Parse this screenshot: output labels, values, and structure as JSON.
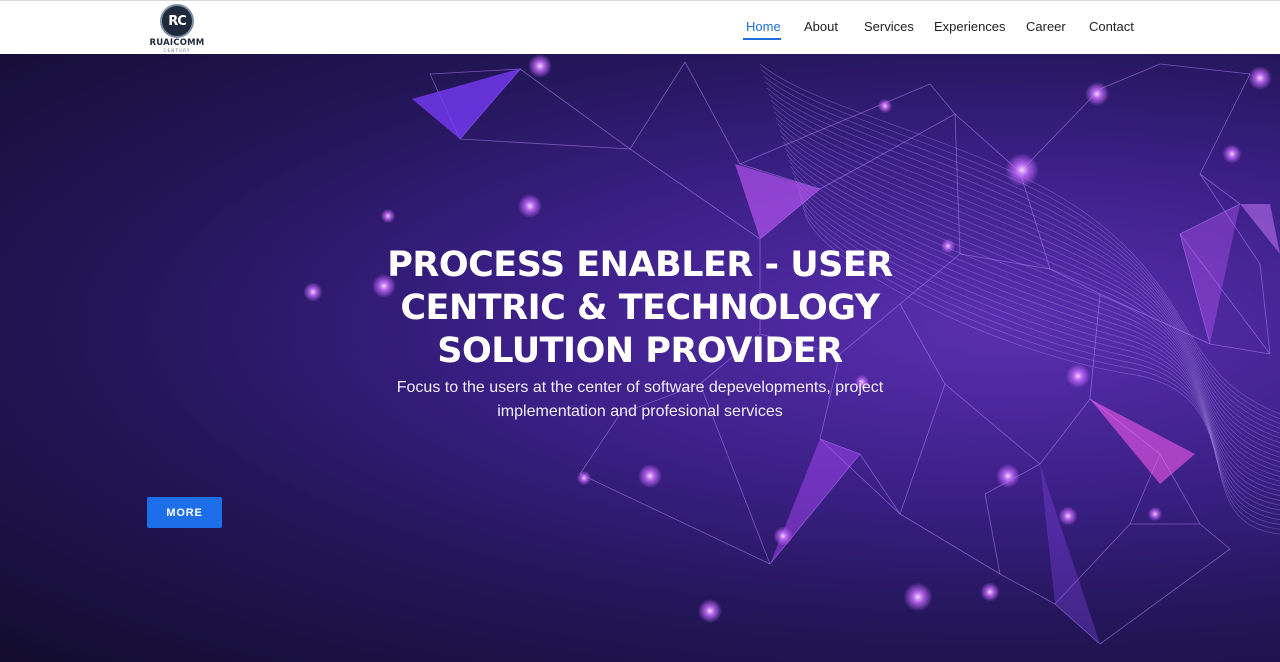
{
  "brand": {
    "logo_mark": "RC",
    "name": "RUAICOMM",
    "tagline": "CENTURY"
  },
  "nav": {
    "items": [
      {
        "label": "Home",
        "active": true
      },
      {
        "label": "About",
        "active": false
      },
      {
        "label": "Services",
        "active": false
      },
      {
        "label": "Experiences",
        "active": false
      },
      {
        "label": "Career",
        "active": false
      },
      {
        "label": "Contact",
        "active": false
      }
    ]
  },
  "hero": {
    "headline_lines": [
      "PROCESS ENABLER - USER",
      "CENTRIC & TECHNOLOGY",
      "SOLUTION PROVIDER"
    ],
    "subheading_lines": [
      "Focus to the users at the center of software depevelopments, project",
      "implementation and profesional services"
    ],
    "cta_label": "MORE"
  },
  "colors": {
    "accent": "#1c6fd9",
    "button": "#1c6fe8",
    "hero_dark": "#120c2e",
    "hero_purple": "#5a2fb0",
    "network_glow": "#c86bff"
  }
}
